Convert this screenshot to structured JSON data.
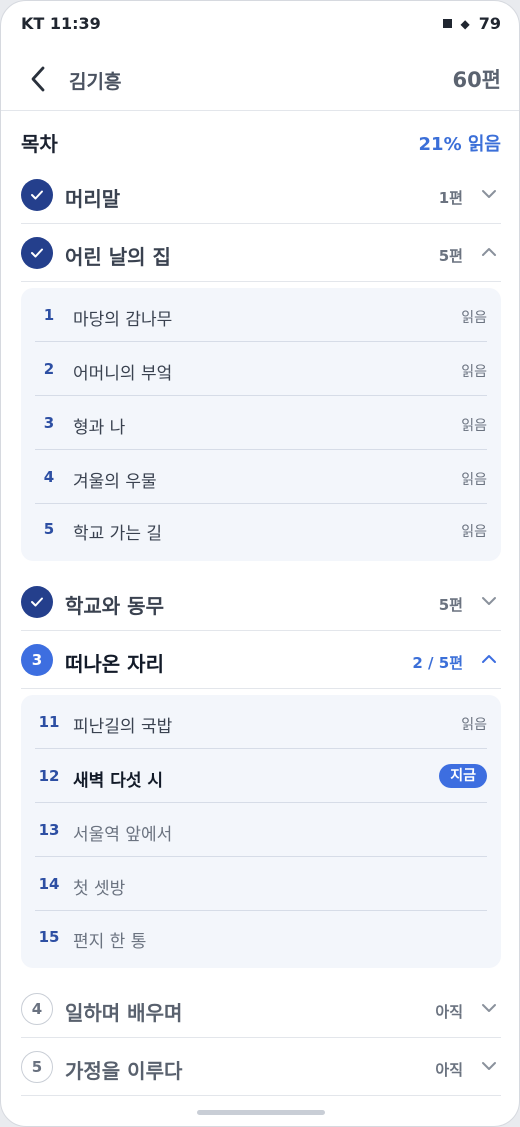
{
  "status_bar": {
    "carrier_time": "KT 11:39",
    "battery": "79"
  },
  "header": {
    "author": "김기흥",
    "count": "60편"
  },
  "toc": {
    "title": "목차",
    "progress": "21% 읽음"
  },
  "chapters": [
    {
      "title": "머리말",
      "meta": "1편",
      "state": "done",
      "expanded": false
    },
    {
      "title": "어린 날의 집",
      "meta": "5편",
      "state": "done",
      "expanded": true,
      "episodes": [
        {
          "num": "1",
          "title": "마당의 감나무",
          "state": "읽음"
        },
        {
          "num": "2",
          "title": "어머니의 부엌",
          "state": "읽음"
        },
        {
          "num": "3",
          "title": "형과 나",
          "state": "읽음"
        },
        {
          "num": "4",
          "title": "겨울의 우물",
          "state": "읽음"
        },
        {
          "num": "5",
          "title": "학교 가는 길",
          "state": "읽음"
        }
      ]
    },
    {
      "title": "학교와 동무",
      "meta": "5편",
      "state": "done",
      "expanded": false
    },
    {
      "badge": "3",
      "title": "떠나온 자리",
      "meta": "2 / 5편",
      "state": "current",
      "expanded": true,
      "episodes": [
        {
          "num": "11",
          "title": "피난길의 국밥",
          "state": "읽음"
        },
        {
          "num": "12",
          "title": "새벽 다섯 시",
          "state": "지금"
        },
        {
          "num": "13",
          "title": "서울역 앞에서",
          "state": ""
        },
        {
          "num": "14",
          "title": "첫 셋방",
          "state": ""
        },
        {
          "num": "15",
          "title": "편지 한 통",
          "state": ""
        }
      ]
    },
    {
      "badge": "4",
      "title": "일하며 배우며",
      "meta": "아직",
      "state": "todo",
      "expanded": false
    },
    {
      "badge": "5",
      "title": "가정을 이루다",
      "meta": "아직",
      "state": "todo",
      "expanded": false
    }
  ],
  "icons": {
    "back": "chevron-left-icon",
    "check": "check-icon",
    "expand": "chevron-down-icon",
    "collapse": "chevron-up-icon"
  },
  "colors": {
    "accent": "#3d6ee0",
    "done": "#243f8c",
    "panel": "#f3f6fb"
  }
}
